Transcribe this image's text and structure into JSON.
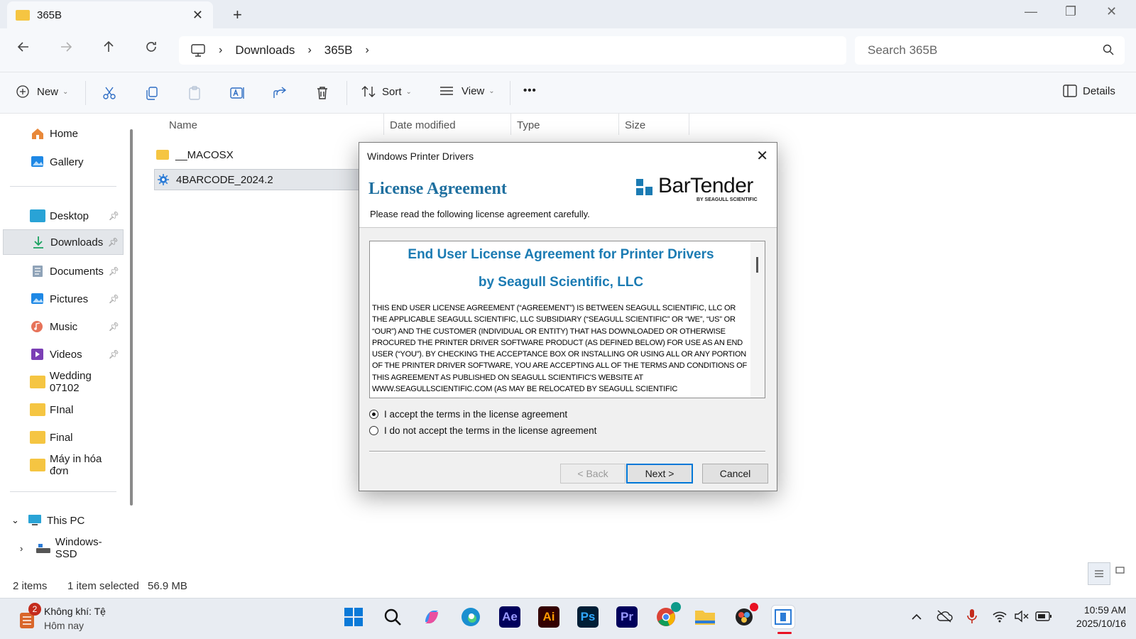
{
  "window": {
    "tab_title": "365B",
    "tab_close": "✕",
    "new_tab": "+",
    "minimize": "—",
    "restore": "❐",
    "close": "✕"
  },
  "address_bar": {
    "separator": "›",
    "crumbs": [
      "Downloads",
      "365B"
    ],
    "search_placeholder": "Search 365B"
  },
  "commands": {
    "new_label": "New",
    "sort_label": "Sort",
    "view_label": "View",
    "more_label": "•••",
    "details_label": "Details"
  },
  "sidebar": {
    "pinned_top": [
      "Home",
      "Gallery"
    ],
    "quick_access": [
      {
        "label": "Desktop",
        "pinned": true
      },
      {
        "label": "Downloads",
        "pinned": true,
        "selected": true
      },
      {
        "label": "Documents",
        "pinned": true
      },
      {
        "label": "Pictures",
        "pinned": true
      },
      {
        "label": "Music",
        "pinned": true
      },
      {
        "label": "Videos",
        "pinned": true
      },
      {
        "label": "Wedding 07102",
        "pinned": false
      },
      {
        "label": "FInal",
        "pinned": false
      },
      {
        "label": "Final",
        "pinned": false
      },
      {
        "label": "Máy in hóa đơn",
        "pinned": false
      }
    ],
    "this_pc": "This PC",
    "drive": "Windows-SSD"
  },
  "file_list": {
    "columns": [
      "Name",
      "Date modified",
      "Type",
      "Size"
    ],
    "rows": [
      {
        "name": "__MACOSX",
        "kind": "folder"
      },
      {
        "name": "4BARCODE_2024.2",
        "kind": "installer",
        "selected": true
      }
    ]
  },
  "status": {
    "item_count": "2 items",
    "selection": "1 item selected",
    "size": "56.9 MB"
  },
  "dialog": {
    "title": "Windows Printer Drivers",
    "heading": "License Agreement",
    "subheading": "Please read the following license agreement carefully.",
    "logo_text": "BarTender",
    "logo_sub": "BY SEAGULL SCIENTIFIC",
    "eula_title_1": "End User License Agreement for Printer Drivers",
    "eula_title_2": "by Seagull Scientific, LLC",
    "eula_body": "THIS END USER LICENSE AGREEMENT (“AGREEMENT”) IS BETWEEN SEAGULL SCIENTIFIC, LLC OR THE APPLICABLE SEAGULL SCIENTIFIC, LLC SUBSIDIARY (“SEAGULL SCIENTIFIC” OR “WE”, “US” OR “OUR”) AND THE CUSTOMER (INDIVIDUAL OR ENTITY) THAT HAS DOWNLOADED OR OTHERWISE PROCURED THE PRINTER DRIVER SOFTWARE PRODUCT (AS DEFINED BELOW) FOR USE AS AN END USER (“YOU”). BY CHECKING THE ACCEPTANCE BOX OR INSTALLING OR USING ALL OR ANY PORTION OF THE PRINTER DRIVER SOFTWARE, YOU ARE ACCEPTING ALL OF THE TERMS AND CONDITIONS OF THIS AGREEMENT AS PUBLISHED ON SEAGULL SCIENTIFIC'S WEBSITE AT WWW.SEAGULLSCIENTIFIC.COM (AS MAY BE RELOCATED BY SEAGULL SCIENTIFIC",
    "accept_label": "I accept the terms in the license agreement",
    "decline_label": "I do not accept the terms in the license agreement",
    "accept_selected": true,
    "back_label": "< Back",
    "next_label": "Next >",
    "cancel_label": "Cancel"
  },
  "taskbar": {
    "weather_title": "Không khí: Tệ",
    "weather_sub": "Hôm nay",
    "weather_badge": "2",
    "time": "10:59 AM",
    "date": "2025/10/16",
    "apps": [
      {
        "name": "ae",
        "label": "Ae",
        "bg": "#00005b",
        "fg": "#9999ff"
      },
      {
        "name": "ai",
        "label": "Ai",
        "bg": "#330000",
        "fg": "#ff9a00"
      },
      {
        "name": "ps",
        "label": "Ps",
        "bg": "#001e36",
        "fg": "#31a8ff"
      },
      {
        "name": "pr",
        "label": "Pr",
        "bg": "#00005b",
        "fg": "#9999ff"
      }
    ]
  },
  "colors": {
    "accent": "#0078d4",
    "dialog_heading": "#1e6f9f",
    "eula_title": "#1b7bb3",
    "folder": "#f5c542"
  }
}
